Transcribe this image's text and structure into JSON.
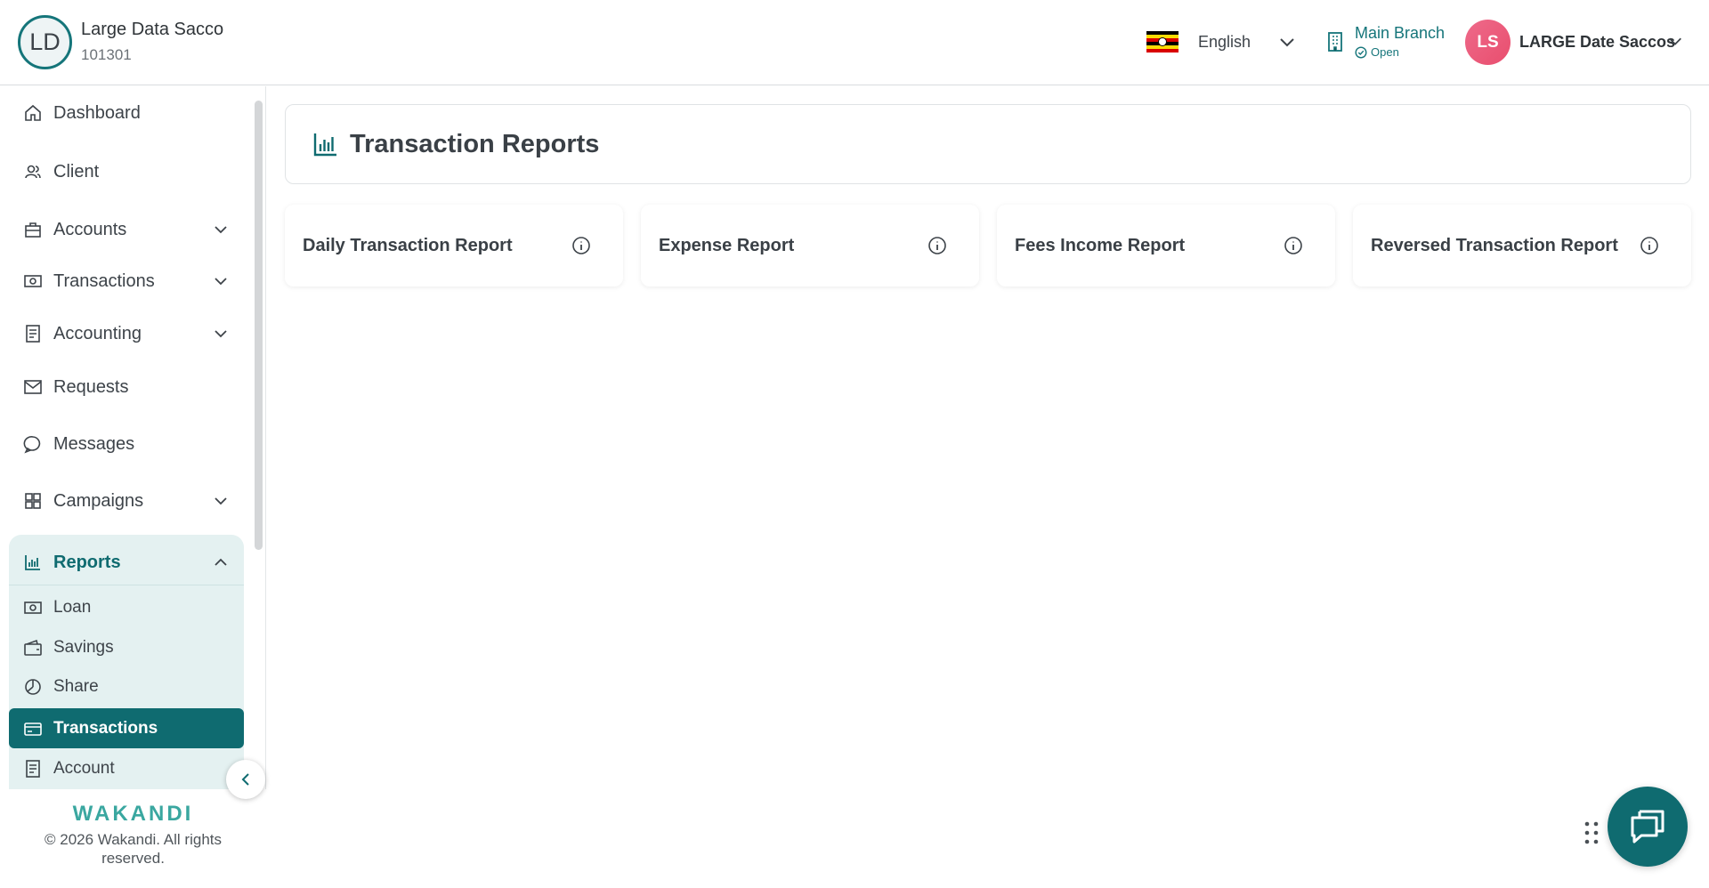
{
  "header": {
    "org_initials": "LD",
    "org_name": "Large Data Sacco",
    "org_code": "101301",
    "language": "English",
    "branch_name": "Main Branch",
    "branch_status": "Open",
    "user_initials": "LS",
    "user_name": "LARGE Date Saccos"
  },
  "sidebar": {
    "items": [
      {
        "label": "Dashboard",
        "icon": "home-icon"
      },
      {
        "label": "Client",
        "icon": "users-icon"
      },
      {
        "label": "Accounts",
        "icon": "briefcase-icon"
      },
      {
        "label": "Transactions",
        "icon": "money-icon"
      },
      {
        "label": "Accounting",
        "icon": "ledger-icon"
      },
      {
        "label": "Requests",
        "icon": "mail-icon"
      },
      {
        "label": "Messages",
        "icon": "chat-icon"
      },
      {
        "label": "Campaigns",
        "icon": "grid-icon"
      }
    ],
    "reports": {
      "label": "Reports",
      "sub_items": [
        {
          "label": "Loan",
          "icon": "money-icon"
        },
        {
          "label": "Savings",
          "icon": "wallet-icon"
        },
        {
          "label": "Share",
          "icon": "pie-icon"
        },
        {
          "label": "Transactions",
          "icon": "card-icon"
        },
        {
          "label": "Account",
          "icon": "ledger-icon"
        }
      ],
      "active": "Transactions"
    },
    "brand": "WAKANDI",
    "copyright": "© 2026 Wakandi. All rights reserved."
  },
  "main": {
    "title": "Transaction Reports",
    "cards": [
      {
        "title": "Daily Transaction Report"
      },
      {
        "title": "Expense Report"
      },
      {
        "title": "Fees Income Report"
      },
      {
        "title": "Reversed Transaction Report"
      }
    ]
  },
  "colors": {
    "primary": "#0f6b70",
    "accent_bg": "#e4f1f1",
    "avatar_pink": "#e94e6e"
  }
}
